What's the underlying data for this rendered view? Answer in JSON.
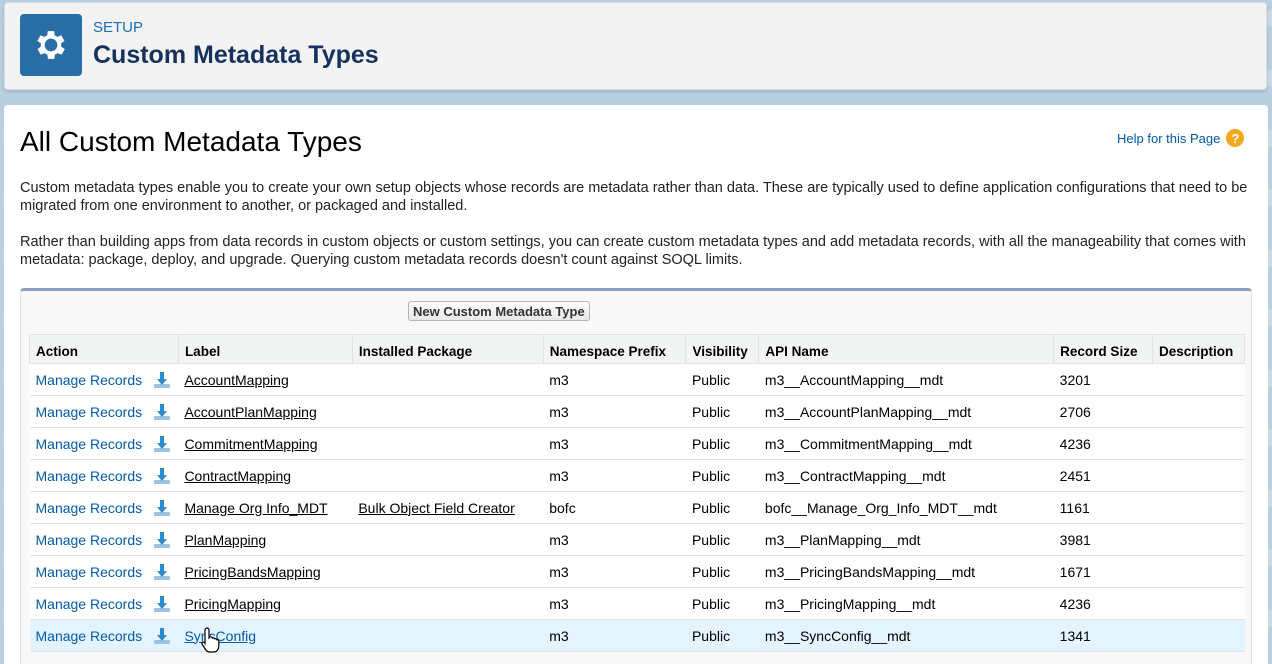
{
  "header": {
    "section": "SETUP",
    "title": "Custom Metadata Types",
    "icon": "gear-icon"
  },
  "page": {
    "title": "All Custom Metadata Types",
    "help_link": "Help for this Page",
    "help_icon": "question-icon",
    "description_1": "Custom metadata types enable you to create your own setup objects whose records are metadata rather than data. These are typically used to define application configurations that need to be migrated from one environment to another, or packaged and installed.",
    "description_2": "Rather than building apps from data records in custom objects or custom settings, you can create custom metadata types and add metadata records, with all the manageability that comes with metadata: package, deploy, and upgrade. Querying custom metadata records doesn't count against SOQL limits."
  },
  "list": {
    "new_button": "New Custom Metadata Type",
    "columns": [
      "Action",
      "Label",
      "Installed Package",
      "Namespace Prefix",
      "Visibility",
      "API Name",
      "Record Size",
      "Description"
    ],
    "rows": [
      {
        "action": "Manage Records",
        "label": "AccountMapping",
        "package": "",
        "namespace": "m3",
        "visibility": "Public",
        "api_name": "m3__AccountMapping__mdt",
        "record_size": "3201",
        "description": ""
      },
      {
        "action": "Manage Records",
        "label": "AccountPlanMapping",
        "package": "",
        "namespace": "m3",
        "visibility": "Public",
        "api_name": "m3__AccountPlanMapping__mdt",
        "record_size": "2706",
        "description": ""
      },
      {
        "action": "Manage Records",
        "label": "CommitmentMapping",
        "package": "",
        "namespace": "m3",
        "visibility": "Public",
        "api_name": "m3__CommitmentMapping__mdt",
        "record_size": "4236",
        "description": ""
      },
      {
        "action": "Manage Records",
        "label": "ContractMapping",
        "package": "",
        "namespace": "m3",
        "visibility": "Public",
        "api_name": "m3__ContractMapping__mdt",
        "record_size": "2451",
        "description": ""
      },
      {
        "action": "Manage Records",
        "label": "Manage Org Info_MDT",
        "package": "Bulk Object Field Creator",
        "namespace": "bofc",
        "visibility": "Public",
        "api_name": "bofc__Manage_Org_Info_MDT__mdt",
        "record_size": "1161",
        "description": ""
      },
      {
        "action": "Manage Records",
        "label": "PlanMapping",
        "package": "",
        "namespace": "m3",
        "visibility": "Public",
        "api_name": "m3__PlanMapping__mdt",
        "record_size": "3981",
        "description": ""
      },
      {
        "action": "Manage Records",
        "label": "PricingBandsMapping",
        "package": "",
        "namespace": "m3",
        "visibility": "Public",
        "api_name": "m3__PricingBandsMapping__mdt",
        "record_size": "1671",
        "description": ""
      },
      {
        "action": "Manage Records",
        "label": "PricingMapping",
        "package": "",
        "namespace": "m3",
        "visibility": "Public",
        "api_name": "m3__PricingMapping__mdt",
        "record_size": "4236",
        "description": ""
      },
      {
        "action": "Manage Records",
        "label": "SyncConfig",
        "package": "",
        "namespace": "m3",
        "visibility": "Public",
        "api_name": "m3__SyncConfig__mdt",
        "record_size": "1341",
        "description": ""
      }
    ]
  },
  "icons": {
    "download": "download-icon",
    "cursor": "hand-pointer-icon"
  },
  "colors": {
    "link": "#015ba7",
    "header_icon_bg": "#2a6ea8",
    "help_icon": "#f4a81d",
    "row_hover": "#e3f3ff"
  }
}
